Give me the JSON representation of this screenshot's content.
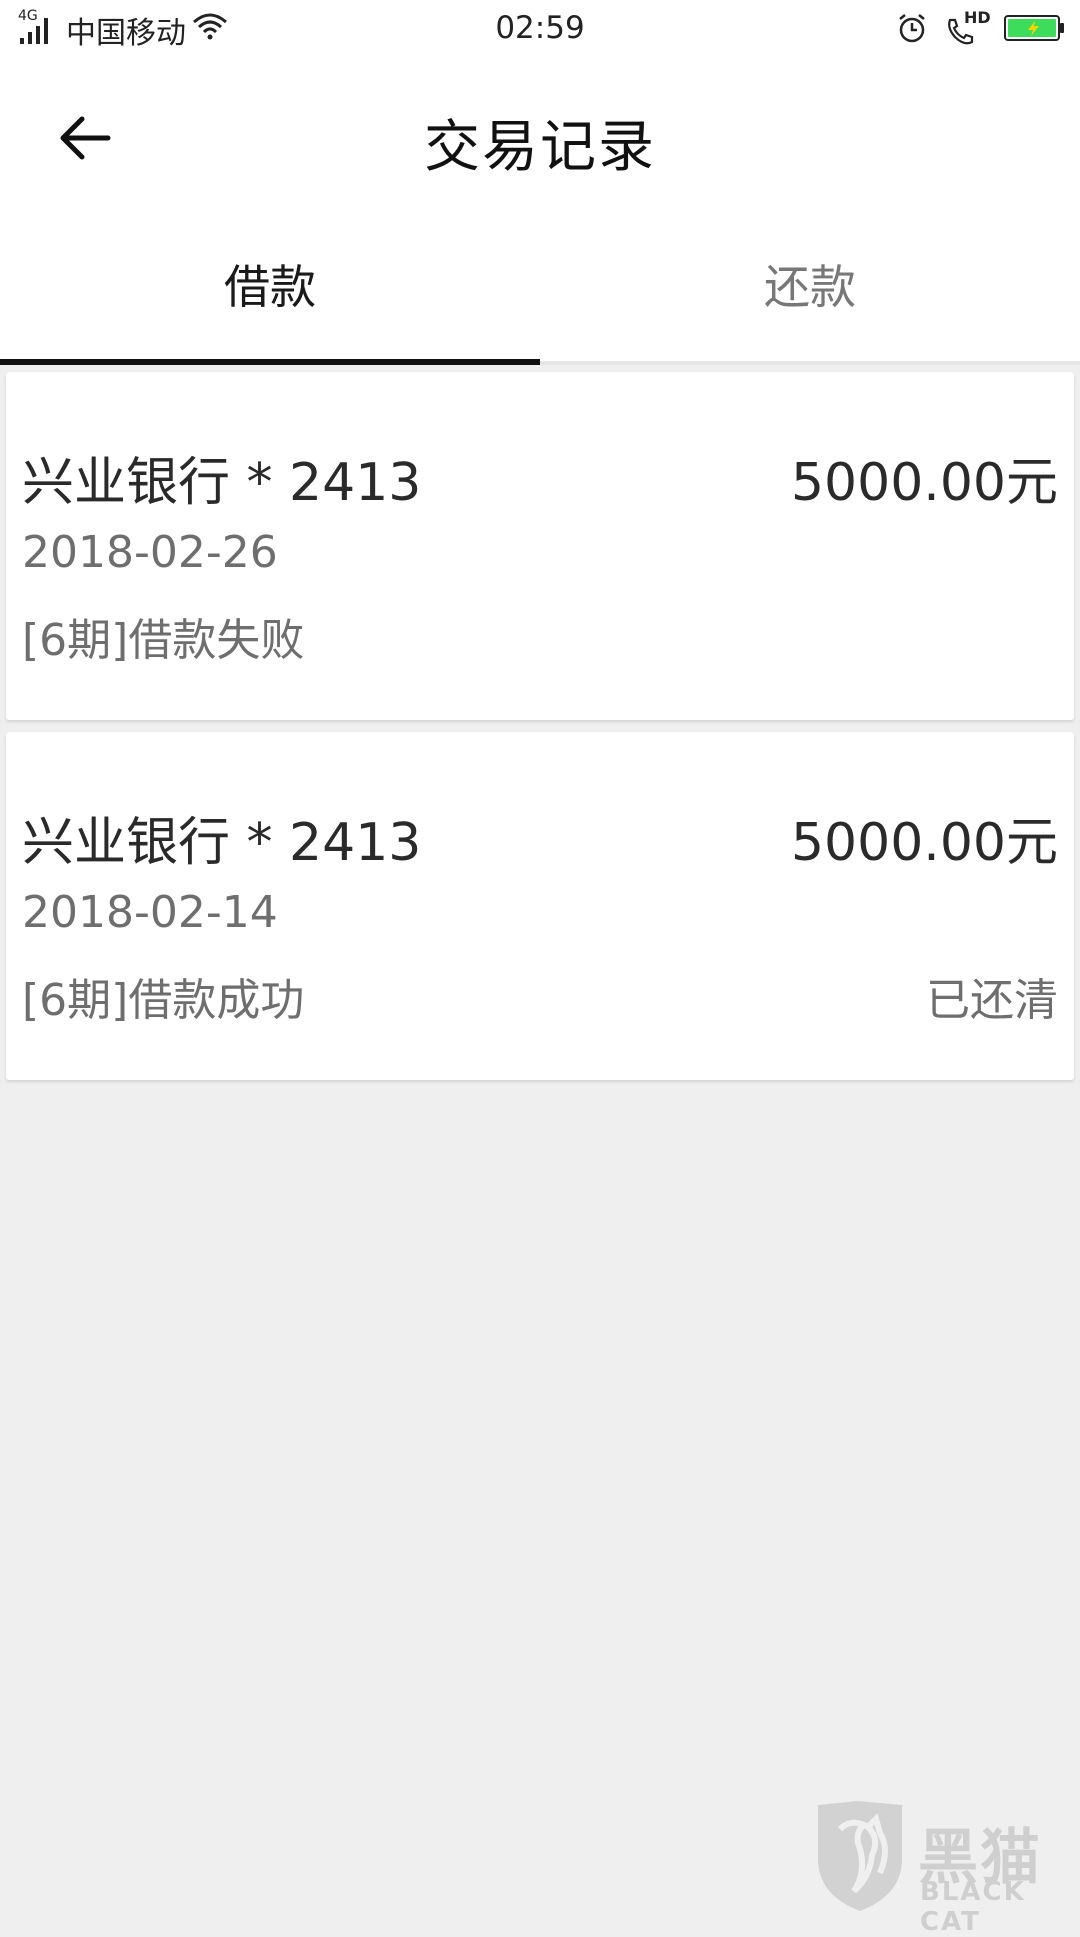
{
  "status_bar": {
    "network": "4G",
    "carrier": "中国移动",
    "time": "02:59",
    "hd": "HD"
  },
  "header": {
    "title": "交易记录"
  },
  "tabs": [
    {
      "label": "借款",
      "active": true
    },
    {
      "label": "还款",
      "active": false
    }
  ],
  "records": [
    {
      "bank": "兴业银行 * 2413",
      "amount": "5000.00元",
      "date": "2018-02-26",
      "status": "[6期]借款失败",
      "repay_status": ""
    },
    {
      "bank": "兴业银行 * 2413",
      "amount": "5000.00元",
      "date": "2018-02-14",
      "status": "[6期]借款成功",
      "repay_status": "已还清"
    }
  ],
  "watermark": {
    "text": "黑猫",
    "sub": "BLACK CAT"
  },
  "colors": {
    "background": "#efefef",
    "active_tab_indicator": "#111111",
    "battery_fill": "#3ddc5a"
  }
}
